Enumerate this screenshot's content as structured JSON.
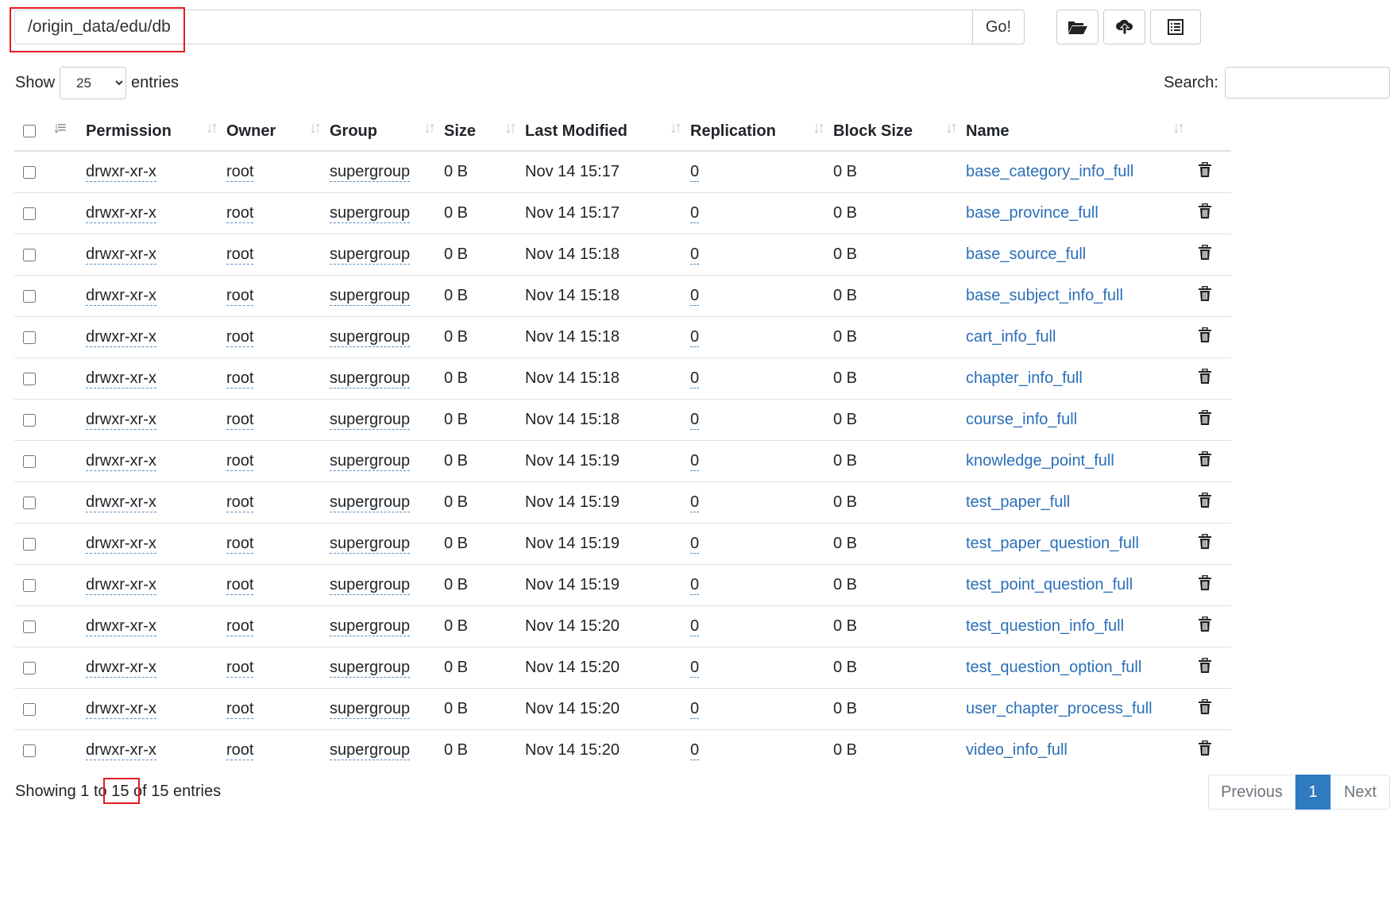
{
  "path_bar": {
    "value": "/origin_data/edu/db",
    "go_label": "Go!"
  },
  "toolbar": {
    "icons": [
      "folder-open-icon",
      "cloud-upload-icon",
      "list-icon"
    ]
  },
  "length_menu": {
    "show": "Show",
    "selected": "25",
    "entries": "entries"
  },
  "search": {
    "label": "Search:",
    "value": ""
  },
  "table": {
    "columns": [
      "Permission",
      "Owner",
      "Group",
      "Size",
      "Last Modified",
      "Replication",
      "Block Size",
      "Name"
    ],
    "rows": [
      {
        "perm": "drwxr-xr-x",
        "owner": "root",
        "group": "supergroup",
        "size": "0 B",
        "modified": "Nov 14 15:17",
        "repl": "0",
        "block": "0 B",
        "name": "base_category_info_full"
      },
      {
        "perm": "drwxr-xr-x",
        "owner": "root",
        "group": "supergroup",
        "size": "0 B",
        "modified": "Nov 14 15:17",
        "repl": "0",
        "block": "0 B",
        "name": "base_province_full"
      },
      {
        "perm": "drwxr-xr-x",
        "owner": "root",
        "group": "supergroup",
        "size": "0 B",
        "modified": "Nov 14 15:18",
        "repl": "0",
        "block": "0 B",
        "name": "base_source_full"
      },
      {
        "perm": "drwxr-xr-x",
        "owner": "root",
        "group": "supergroup",
        "size": "0 B",
        "modified": "Nov 14 15:18",
        "repl": "0",
        "block": "0 B",
        "name": "base_subject_info_full"
      },
      {
        "perm": "drwxr-xr-x",
        "owner": "root",
        "group": "supergroup",
        "size": "0 B",
        "modified": "Nov 14 15:18",
        "repl": "0",
        "block": "0 B",
        "name": "cart_info_full"
      },
      {
        "perm": "drwxr-xr-x",
        "owner": "root",
        "group": "supergroup",
        "size": "0 B",
        "modified": "Nov 14 15:18",
        "repl": "0",
        "block": "0 B",
        "name": "chapter_info_full"
      },
      {
        "perm": "drwxr-xr-x",
        "owner": "root",
        "group": "supergroup",
        "size": "0 B",
        "modified": "Nov 14 15:18",
        "repl": "0",
        "block": "0 B",
        "name": "course_info_full"
      },
      {
        "perm": "drwxr-xr-x",
        "owner": "root",
        "group": "supergroup",
        "size": "0 B",
        "modified": "Nov 14 15:19",
        "repl": "0",
        "block": "0 B",
        "name": "knowledge_point_full"
      },
      {
        "perm": "drwxr-xr-x",
        "owner": "root",
        "group": "supergroup",
        "size": "0 B",
        "modified": "Nov 14 15:19",
        "repl": "0",
        "block": "0 B",
        "name": "test_paper_full"
      },
      {
        "perm": "drwxr-xr-x",
        "owner": "root",
        "group": "supergroup",
        "size": "0 B",
        "modified": "Nov 14 15:19",
        "repl": "0",
        "block": "0 B",
        "name": "test_paper_question_full"
      },
      {
        "perm": "drwxr-xr-x",
        "owner": "root",
        "group": "supergroup",
        "size": "0 B",
        "modified": "Nov 14 15:19",
        "repl": "0",
        "block": "0 B",
        "name": "test_point_question_full"
      },
      {
        "perm": "drwxr-xr-x",
        "owner": "root",
        "group": "supergroup",
        "size": "0 B",
        "modified": "Nov 14 15:20",
        "repl": "0",
        "block": "0 B",
        "name": "test_question_info_full"
      },
      {
        "perm": "drwxr-xr-x",
        "owner": "root",
        "group": "supergroup",
        "size": "0 B",
        "modified": "Nov 14 15:20",
        "repl": "0",
        "block": "0 B",
        "name": "test_question_option_full"
      },
      {
        "perm": "drwxr-xr-x",
        "owner": "root",
        "group": "supergroup",
        "size": "0 B",
        "modified": "Nov 14 15:20",
        "repl": "0",
        "block": "0 B",
        "name": "user_chapter_process_full"
      },
      {
        "perm": "drwxr-xr-x",
        "owner": "root",
        "group": "supergroup",
        "size": "0 B",
        "modified": "Nov 14 15:20",
        "repl": "0",
        "block": "0 B",
        "name": "video_info_full"
      }
    ]
  },
  "footer": {
    "info_prefix": "Showing 1 to ",
    "info_count": "15",
    "info_suffix": " of 15 entries"
  },
  "pagination": {
    "previous": "Previous",
    "current": "1",
    "next": "Next"
  },
  "colors": {
    "link": "#2a6fb7",
    "active_page": "#2e7bbf",
    "highlight": "#e31b23"
  }
}
